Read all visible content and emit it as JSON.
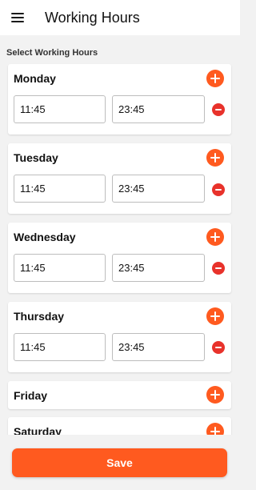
{
  "header": {
    "menu_icon": "hamburger-menu-icon",
    "title": "Working Hours"
  },
  "section_label": "Select Working Hours",
  "colors": {
    "accent": "#ff5a1f",
    "remove": "#e8322b",
    "background": "#f2f2f2"
  },
  "days": [
    {
      "name": "Monday",
      "start": "11:45",
      "end": "23:45"
    },
    {
      "name": "Tuesday",
      "start": "11:45",
      "end": "23:45"
    },
    {
      "name": "Wednesday",
      "start": "11:45",
      "end": "23:45"
    },
    {
      "name": "Thursday",
      "start": "11:45",
      "end": "23:45"
    },
    {
      "name": "Friday"
    },
    {
      "name": "Saturday"
    }
  ],
  "footer": {
    "save_label": "Save"
  }
}
